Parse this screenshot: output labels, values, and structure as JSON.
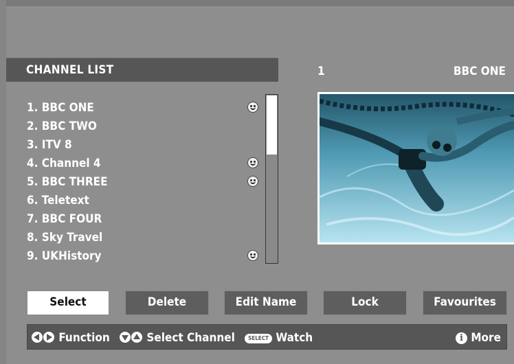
{
  "header": {
    "title": "CHANNEL LIST"
  },
  "preview": {
    "channel_number": "1",
    "channel_name": "BBC ONE"
  },
  "channels": [
    {
      "label": "1. BBC ONE",
      "favourite": true
    },
    {
      "label": "2. BBC TWO",
      "favourite": false
    },
    {
      "label": "3. ITV 8",
      "favourite": false
    },
    {
      "label": "4. Channel 4",
      "favourite": true
    },
    {
      "label": "5. BBC THREE",
      "favourite": true
    },
    {
      "label": "6. Teletext",
      "favourite": false
    },
    {
      "label": "7. BBC FOUR",
      "favourite": false
    },
    {
      "label": "8. Sky Travel",
      "favourite": false
    },
    {
      "label": "9. UKHistory",
      "favourite": true
    }
  ],
  "buttons": {
    "select": "Select",
    "delete": "Delete",
    "edit_name": "Edit Name",
    "lock": "Lock",
    "favourites": "Favourites"
  },
  "help": {
    "function": "Function",
    "select_channel": "Select Channel",
    "select_key": "SELECT",
    "watch": "Watch",
    "info_key": "i",
    "more": "More"
  },
  "colors": {
    "background": "#8e8e8e",
    "panel": "#565656",
    "active_button": "#ffffff"
  }
}
